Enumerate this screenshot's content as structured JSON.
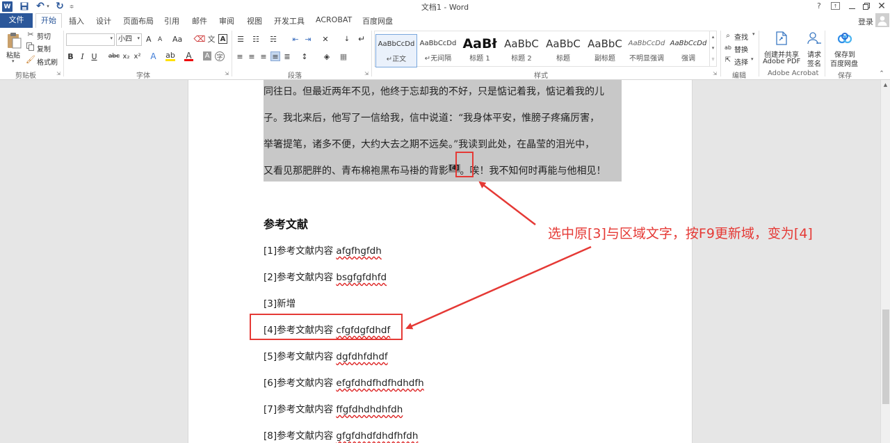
{
  "window": {
    "title": "文档1 - Word",
    "help": "?",
    "login": "登录"
  },
  "tabs": [
    "文件",
    "开始",
    "插入",
    "设计",
    "页面布局",
    "引用",
    "邮件",
    "审阅",
    "视图",
    "开发工具",
    "ACROBAT",
    "百度网盘"
  ],
  "ribbon": {
    "clipboard": {
      "paste": "粘贴",
      "cut": "剪切",
      "copy": "复制",
      "painter": "格式刷",
      "label": "剪贴板"
    },
    "font": {
      "name": "",
      "size": "小四",
      "grow": "A",
      "shrink": "A",
      "case": "Aa",
      "label": "字体"
    },
    "paragraph": {
      "label": "段落"
    },
    "styles": {
      "label": "样式",
      "items": [
        {
          "preview": "AaBbCcDd",
          "name": "正文"
        },
        {
          "preview": "AaBbCcDd",
          "name": "无间隔"
        },
        {
          "preview": "AaBł",
          "name": "标题 1"
        },
        {
          "preview": "AaBbC",
          "name": "标题 2"
        },
        {
          "preview": "AaBbC",
          "name": "标题"
        },
        {
          "preview": "AaBbC",
          "name": "副标题"
        },
        {
          "preview": "AaBbCcDd",
          "name": "不明显强调"
        },
        {
          "preview": "AaBbCcDd",
          "name": "强调"
        }
      ]
    },
    "editing": {
      "find": "查找",
      "replace": "替换",
      "select": "选择",
      "label": "编辑"
    },
    "acrobat": {
      "create_pdf_1": "创建并共享",
      "create_pdf_2": "Adobe PDF",
      "request_1": "请求",
      "request_2": "签名",
      "label": "Adobe Acrobat"
    },
    "baidu": {
      "save_1": "保存到",
      "save_2": "百度网盘",
      "label": "保存"
    }
  },
  "document": {
    "paragraph_lines": [
      "同往日。但最近两年不见，他终于忘却我的不好，只是惦记着我，惦记着我的儿",
      "子。我北来后，他写了一信给我，信中说道：“我身体平安，惟膀子疼痛厉害，",
      "举箸提笔，诸多不便，大约大去之期不远矣。”我读到此处，在晶莹的泪光中，",
      "又看见那肥胖的、青布棉袍黑布马褂的背影"
    ],
    "footnote_mark": "[4]",
    "line4_tail": "。唉！我不知何时再能与他相见！",
    "heading": "参考文献",
    "references": [
      {
        "num": "[1]",
        "text": "参考文献内容 ",
        "tag": "afgfhgfdh"
      },
      {
        "num": "[2]",
        "text": "参考文献内容 ",
        "tag": "bsgfgfdhfd"
      },
      {
        "num": "[3]",
        "text": "新增",
        "tag": ""
      },
      {
        "num": "[4]",
        "text": "参考文献内容 ",
        "tag": "cfgfdgfdhdf"
      },
      {
        "num": "[5]",
        "text": "参考文献内容 ",
        "tag": "dgfdhfdhdf"
      },
      {
        "num": "[6]",
        "text": "参考文献内容 ",
        "tag": "efgfdhdfhdfhdhdfh"
      },
      {
        "num": "[7]",
        "text": "参考文献内容 ",
        "tag": "ffgfdhdhdhfdh"
      },
      {
        "num": "[8]",
        "text": "参考文献内容 ",
        "tag": "gfgfdhdfdhdfhfdh"
      }
    ]
  },
  "annotation": {
    "text": "选中原[3]与区域文字，按F9更新域，变为[4]",
    "color": "#e53935"
  }
}
